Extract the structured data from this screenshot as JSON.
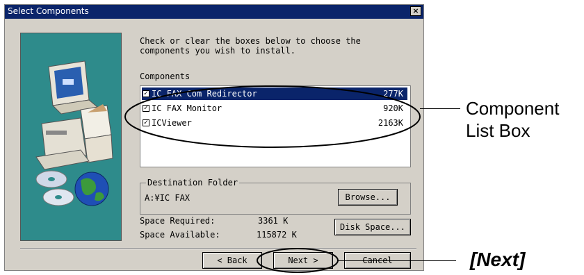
{
  "window": {
    "title": "Select Components",
    "close_glyph": "×"
  },
  "instructions": "Check or clear the boxes below to choose the\ncomponents you wish to install.",
  "components": {
    "label": "Components",
    "items": [
      {
        "name": "IC FAX Com Redirector",
        "size": "277K",
        "checked": true,
        "selected": true
      },
      {
        "name": "IC FAX Monitor",
        "size": "920K",
        "checked": true,
        "selected": false
      },
      {
        "name": "ICViewer",
        "size": "2163K",
        "checked": true,
        "selected": false
      }
    ]
  },
  "destination": {
    "label": "Destination Folder",
    "path": "A:¥IC FAX",
    "browse_label": "Browse..."
  },
  "space": {
    "required_label": "Space Required:",
    "required_value": "3361 K",
    "available_label": "Space Available:",
    "available_value": "115872 K",
    "disk_space_label": "Disk Space..."
  },
  "buttons": {
    "back": "< Back",
    "next": "Next >",
    "cancel": "Cancel"
  },
  "callouts": {
    "list_box_line1": "Component",
    "list_box_line2": "List Box",
    "next": "[Next]"
  },
  "colors": {
    "dialog": "#d4d0c8",
    "titlebar": "#0a246a",
    "art_bg": "#2e8b8b",
    "selection": "#0a246a"
  }
}
